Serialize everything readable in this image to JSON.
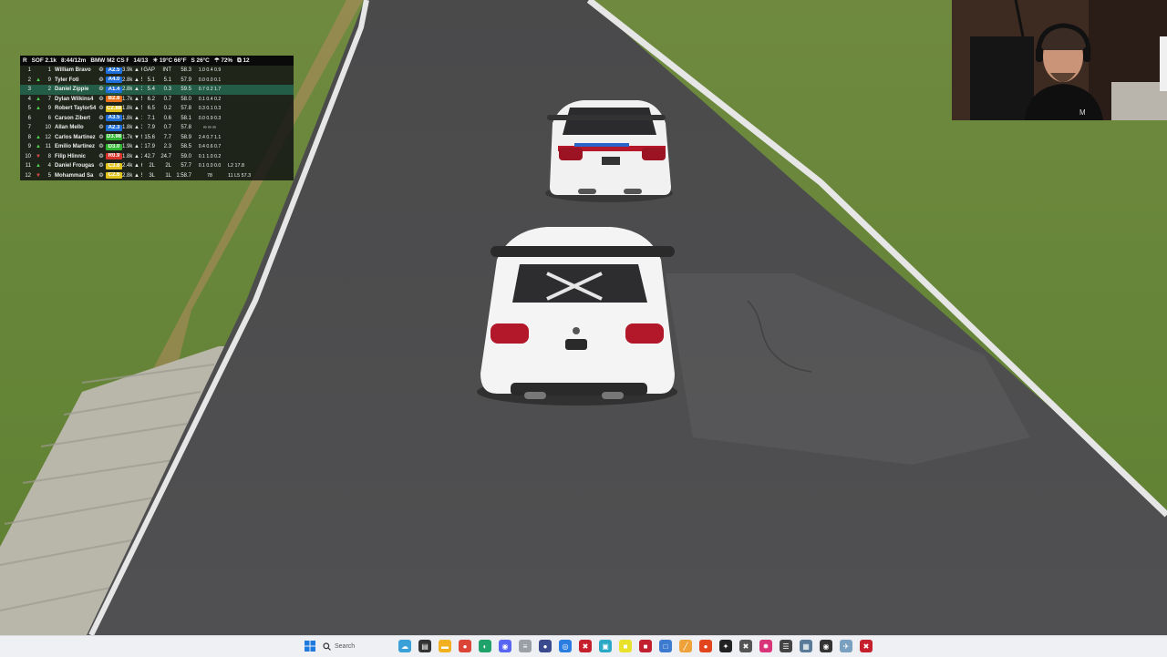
{
  "hud": {
    "header": {
      "race_label": "R",
      "sof": "SOF 2.1k",
      "session_time": "8:44/12m",
      "car_class": "BMW M2 CS Ra",
      "lap": "14/13",
      "air_temp": "☀ 19°C 66°F",
      "track_temp": "S 26°C",
      "humidity": "☂ 72%",
      "incidents": "⧉ 12"
    },
    "rows": [
      {
        "pos": "1",
        "chg": "",
        "chg_dir": "",
        "grid": "1",
        "name": "William Bravo",
        "icon": "❂",
        "lic": "A2.5",
        "lic_color": "#1e6fd9",
        "ir": "3.9k ▲ 63",
        "gap": "GAP",
        "int": "INT",
        "lap": "58.3",
        "sec": "1.0 0.4 0.9",
        "extra": "",
        "highlight": false
      },
      {
        "pos": "2",
        "chg": "▲",
        "chg_dir": "up",
        "grid": "9",
        "name": "Tyler Foti",
        "icon": "❂",
        "lic": "A4.0",
        "lic_color": "#1e6fd9",
        "ir": "2.8k ▲ 53",
        "gap": "5.1",
        "int": "5.1",
        "lap": "57.9",
        "sec": "0.0 0.0 0.1",
        "extra": "",
        "highlight": false
      },
      {
        "pos": "3",
        "chg": "",
        "chg_dir": "",
        "grid": "2",
        "name": "Daniel Zippie",
        "icon": "❂",
        "lic": "A1.4",
        "lic_color": "#1e6fd9",
        "ir": "2.8k ▲ 36",
        "gap": "5.4",
        "int": "0.3",
        "lap": "59.5",
        "sec": "0.7 0.2 1.7",
        "extra": "",
        "highlight": true
      },
      {
        "pos": "4",
        "chg": "▲",
        "chg_dir": "up",
        "grid": "7",
        "name": "Dylan Wilkins4",
        "icon": "❂",
        "lic": "B2.8",
        "lic_color": "#e8731e",
        "ir": "1.7k ▲ 57",
        "gap": "6.2",
        "int": "0.7",
        "lap": "58.0",
        "sec": "0.1 0.4 0.2",
        "extra": "",
        "highlight": false
      },
      {
        "pos": "5",
        "chg": "▲",
        "chg_dir": "up",
        "grid": "9",
        "name": "Robert Taylor54",
        "icon": "❂",
        "lic": "C2.88",
        "lic_color": "#e2c21c",
        "ir": "1.8k ▲ 55",
        "gap": "6.5",
        "int": "0.2",
        "lap": "57.8",
        "sec": "0.3 0.1 0.3",
        "extra": "",
        "highlight": false
      },
      {
        "pos": "6",
        "chg": "",
        "chg_dir": "",
        "grid": "6",
        "name": "Carson Zibert",
        "icon": "❂",
        "lic": "A3.5",
        "lic_color": "#1e6fd9",
        "ir": "1.8k ▲ 17",
        "gap": "7.1",
        "int": "0.6",
        "lap": "58.1",
        "sec": "0.0 0.9 0.3",
        "extra": "",
        "highlight": false
      },
      {
        "pos": "7",
        "chg": "",
        "chg_dir": "",
        "grid": "10",
        "name": "Allan Mello",
        "icon": "❂",
        "lic": "A2.3",
        "lic_color": "#1e6fd9",
        "ir": "1.8k ▲ 3",
        "gap": "7.9",
        "int": "0.7",
        "lap": "57.8",
        "sec": "∞ ∞ ∞",
        "extra": "",
        "highlight": false
      },
      {
        "pos": "8",
        "chg": "▲",
        "chg_dir": "up",
        "grid": "12",
        "name": "Carlos Martinez",
        "icon": "❂",
        "lic": "D3.98",
        "lic_color": "#2fb52f",
        "ir": "1.7k ▼ 9",
        "gap": "15.6",
        "int": "7.7",
        "lap": "58.9",
        "sec": "2.4 0.7 1.1",
        "extra": "",
        "highlight": false
      },
      {
        "pos": "9",
        "chg": "▲",
        "chg_dir": "up",
        "grid": "11",
        "name": "Emilio Martinez",
        "icon": "❂",
        "lic": "D3.0",
        "lic_color": "#2fb52f",
        "ir": "1.9k ▲ 35",
        "gap": "17.9",
        "int": "2.3",
        "lap": "58.5",
        "sec": "0.4 0.6 0.7",
        "extra": "",
        "highlight": false
      },
      {
        "pos": "10",
        "chg": "▼",
        "chg_dir": "dn",
        "grid": "8",
        "name": "Filip Hlinnic",
        "icon": "❂",
        "lic": "R0.9",
        "lic_color": "#d9342b",
        "ir": "1.8k ▲ 27",
        "gap": "42.7",
        "int": "24.7",
        "lap": "59.0",
        "sec": "0.1 1.0 0.2",
        "extra": "",
        "highlight": false
      },
      {
        "pos": "11",
        "chg": "▲",
        "chg_dir": "up",
        "grid": "4",
        "name": "Daniel Frougas",
        "icon": "❂",
        "lic": "C3.8",
        "lic_color": "#e2c21c",
        "ir": "2.4k ▲ 64",
        "gap": "2L",
        "int": "2L",
        "lap": "57.7",
        "sec": "0.1 0.0 0.0",
        "extra": "L2 17.8",
        "highlight": false
      },
      {
        "pos": "12",
        "chg": "▼",
        "chg_dir": "dn",
        "grid": "5",
        "name": "Mohammad Sa",
        "icon": "❂",
        "lic": "C2.6",
        "lic_color": "#e2c21c",
        "ir": "2.8k ▲ 50",
        "gap": "3L",
        "int": "1L",
        "lap": "1:58.7",
        "sec": "78",
        "extra": "11 L5 57.3",
        "highlight": false
      }
    ]
  },
  "taskbar": {
    "search_placeholder": "Search",
    "icons": [
      {
        "name": "widgets-icon",
        "color": "#3aa0d8",
        "glyph": "☁"
      },
      {
        "name": "file-explorer-icon",
        "color": "#333",
        "glyph": "▤"
      },
      {
        "name": "folder-icon",
        "color": "#f2b01e",
        "glyph": "▬"
      },
      {
        "name": "chrome-icon",
        "color": "#db4437",
        "glyph": "●"
      },
      {
        "name": "edge-icon",
        "color": "#1fa36a",
        "glyph": "◐"
      },
      {
        "name": "discord-icon",
        "color": "#5865f2",
        "glyph": "◉"
      },
      {
        "name": "tools-icon",
        "color": "#9aa0a6",
        "glyph": "≡"
      },
      {
        "name": "obs-icon",
        "color": "#3b4a8f",
        "glyph": "●"
      },
      {
        "name": "teamspeak-icon",
        "color": "#2a7de1",
        "glyph": "◎"
      },
      {
        "name": "iracing-icon",
        "color": "#c6202d",
        "glyph": "✖"
      },
      {
        "name": "app-icon",
        "color": "#2aa8c6",
        "glyph": "▣"
      },
      {
        "name": "app2-icon",
        "color": "#e8e22a",
        "glyph": "■"
      },
      {
        "name": "app3-icon",
        "color": "#c21f30",
        "glyph": "■"
      },
      {
        "name": "app4-icon",
        "color": "#3c7bd0",
        "glyph": "□"
      },
      {
        "name": "app5-icon",
        "color": "#f0a23a",
        "glyph": "╱"
      },
      {
        "name": "app6-icon",
        "color": "#e2441e",
        "glyph": "●"
      },
      {
        "name": "app7-icon",
        "color": "#222",
        "glyph": "✦"
      },
      {
        "name": "app8-icon",
        "color": "#555",
        "glyph": "✖"
      },
      {
        "name": "app9-icon",
        "color": "#d9337a",
        "glyph": "✹"
      },
      {
        "name": "app10-icon",
        "color": "#444",
        "glyph": "☰"
      },
      {
        "name": "app11-icon",
        "color": "#5a7a9a",
        "glyph": "▦"
      },
      {
        "name": "app12-icon",
        "color": "#333",
        "glyph": "◉"
      },
      {
        "name": "app13-icon",
        "color": "#7aa0c0",
        "glyph": "✈"
      },
      {
        "name": "app14-icon",
        "color": "#c6202d",
        "glyph": "✖"
      }
    ]
  }
}
